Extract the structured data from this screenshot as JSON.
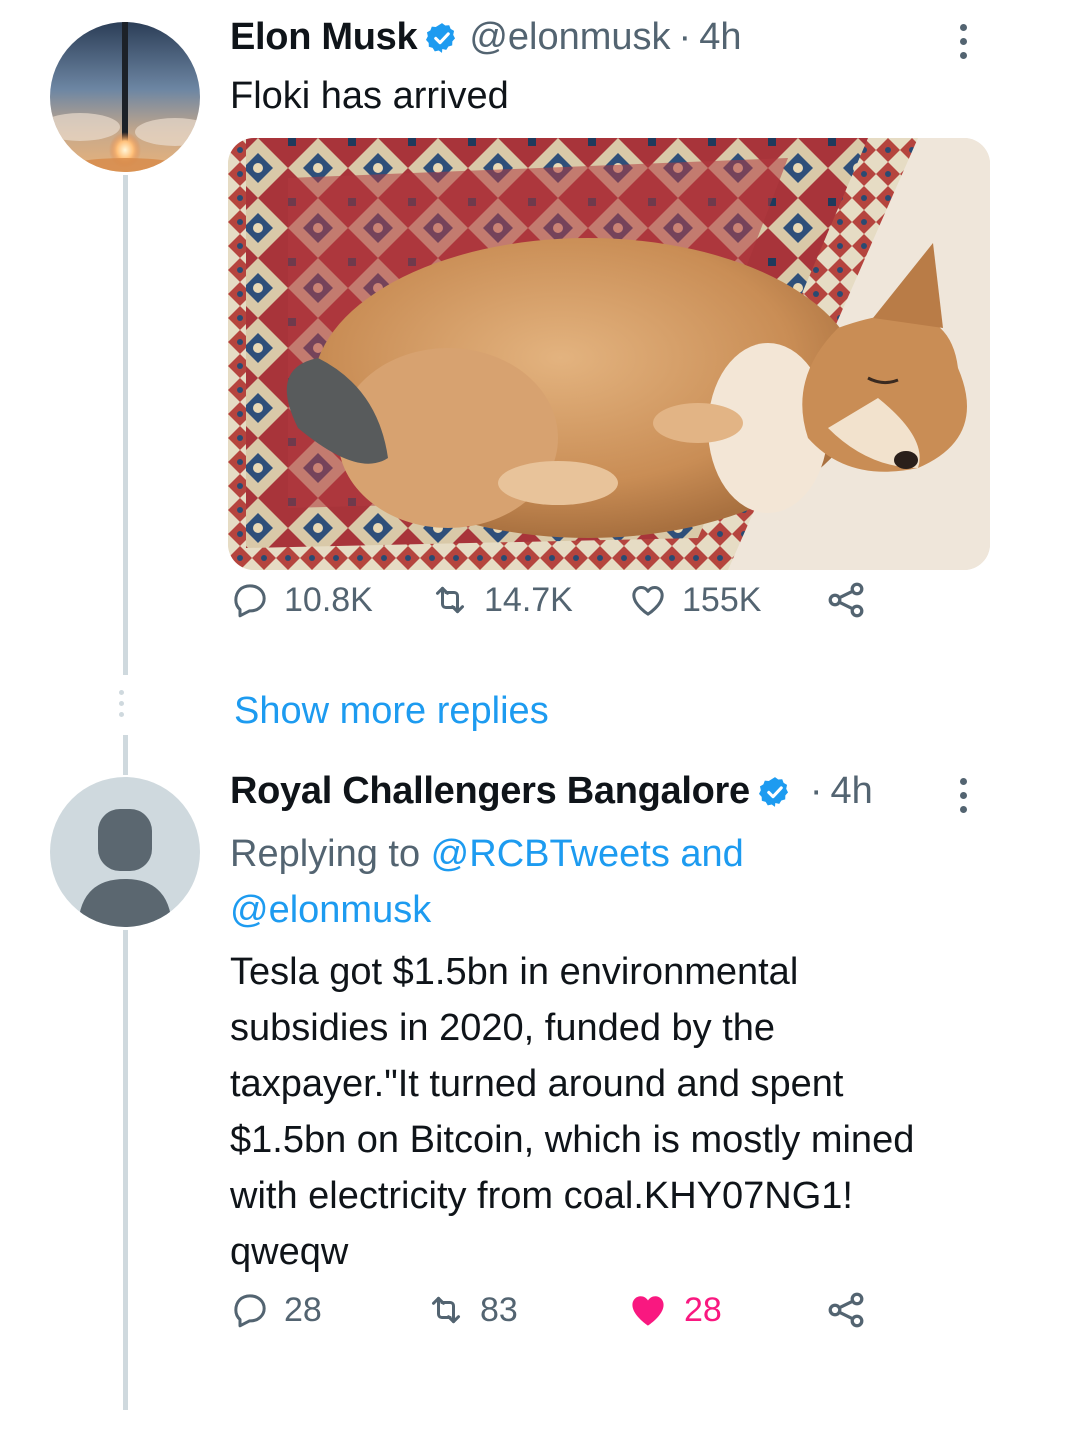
{
  "colors": {
    "accent": "#1d9bf0",
    "like_active": "#f91880",
    "secondary_text": "#536471",
    "thread_line": "#cfd9de"
  },
  "tweet1": {
    "name": "Elon Musk",
    "handle": "@elonmusk",
    "separator": "·",
    "time": "4h",
    "text": "Floki has arrived",
    "stats": {
      "replies": "10.8K",
      "retweets": "14.7K",
      "likes": "155K"
    }
  },
  "show_more": "Show more replies",
  "tweet2": {
    "name": "Royal Challengers Bangalore",
    "separator": "·",
    "time": "4h",
    "replying_prefix": "Replying to ",
    "replying_users": "@RCBTweets and @elonmusk",
    "lines": [
      "Tesla got $1.5bn in environmental",
      "subsidies in 2020, funded by the",
      "taxpayer.\"It turned around and spent",
      "$1.5bn on Bitcoin, which is mostly mined",
      "with electricity from coal.KHY07NG1!",
      "qweqw"
    ],
    "stats": {
      "replies": "28",
      "retweets": "83",
      "likes": "28"
    },
    "liked": true
  },
  "icons": [
    "verified-badge-icon",
    "more-options-icon",
    "reply-icon",
    "retweet-icon",
    "like-icon",
    "share-icon"
  ]
}
